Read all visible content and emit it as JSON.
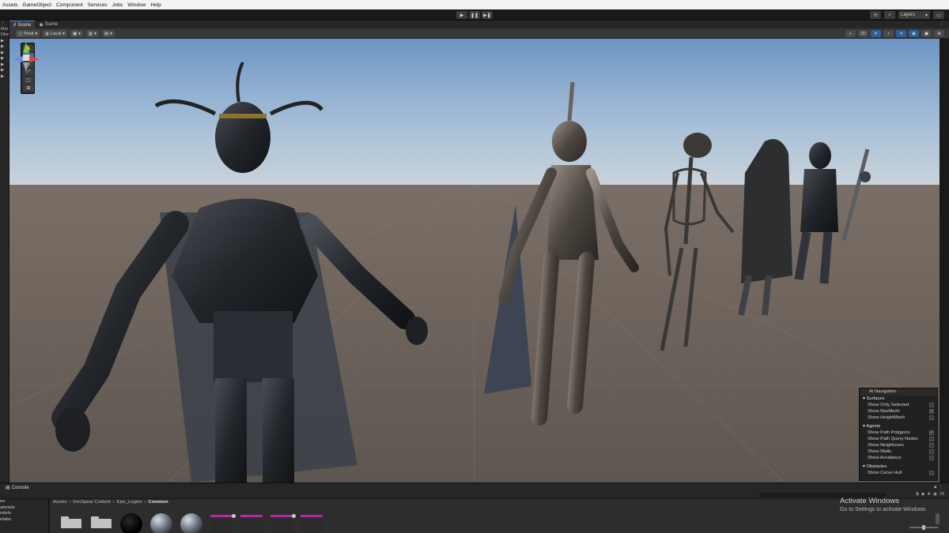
{
  "menu": [
    "Assets",
    "GameObject",
    "Component",
    "Services",
    "Jobs",
    "Window",
    "Help"
  ],
  "toolbar": {
    "play": "▶",
    "pause": "❚❚",
    "step": "▶❚",
    "layers_label": "Layers"
  },
  "hierarchy_rows": [
    "Mai",
    "Dire",
    "▶",
    "▶",
    "▶",
    "▶",
    "▶",
    "▶",
    "▶"
  ],
  "scene_tabs": [
    {
      "label": "Scene",
      "icon": "grid-icon"
    },
    {
      "label": "Game",
      "icon": "gamepad-icon"
    }
  ],
  "scene_toolbar": {
    "pivot_label": "Pivot",
    "space_label": "Local",
    "mode_2d_label": "2D"
  },
  "ai_navigation": {
    "title": "AI Navigation",
    "sections": [
      {
        "name": "Surfaces",
        "options": [
          {
            "label": "Show Only Selected",
            "checked": false
          },
          {
            "label": "Show NavMesh",
            "checked": true
          },
          {
            "label": "Show HeightMesh",
            "checked": false
          }
        ]
      },
      {
        "name": "Agents",
        "options": [
          {
            "label": "Show Path Polygons",
            "checked": true
          },
          {
            "label": "Show Path Query Nodes",
            "checked": false
          },
          {
            "label": "Show Neighbours",
            "checked": false
          },
          {
            "label": "Show Walls",
            "checked": false
          },
          {
            "label": "Show Avoidance",
            "checked": false
          }
        ]
      },
      {
        "name": "Obstacles",
        "options": [
          {
            "label": "Show Carve Hull",
            "checked": false
          }
        ]
      }
    ]
  },
  "console": {
    "tab_label": "Console",
    "count_label": "18"
  },
  "project_tree": [
    "es",
    "aterials",
    "odels",
    "efabs"
  ],
  "breadcrumbs": [
    "Assets",
    "IronSpear Content",
    "Epic_Legion",
    "Common"
  ],
  "watermark": {
    "title": "Activate Windows",
    "subtitle": "Go to Settings to activate Windows"
  }
}
